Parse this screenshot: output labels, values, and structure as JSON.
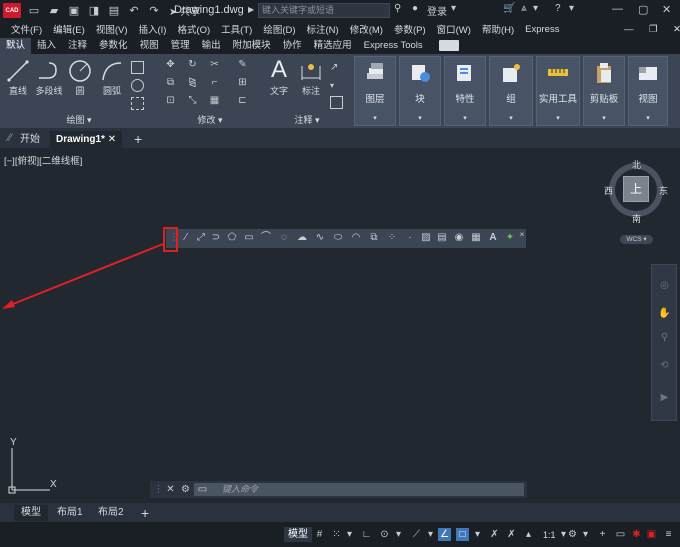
{
  "titlebar": {
    "logo": "CAD",
    "share": "共享",
    "document": "Drawing1.dwg",
    "search_placeholder": "键入关键字或短语",
    "login": "登录"
  },
  "menu": [
    "文件(F)",
    "编辑(E)",
    "视图(V)",
    "插入(I)",
    "格式(O)",
    "工具(T)",
    "绘图(D)",
    "标注(N)",
    "修改(M)",
    "参数(P)",
    "窗口(W)",
    "帮助(H)",
    "Express"
  ],
  "ribbon_tabs": [
    "默认",
    "插入",
    "注释",
    "参数化",
    "视图",
    "管理",
    "输出",
    "附加模块",
    "协作",
    "精选应用",
    "Express Tools"
  ],
  "ribbon": {
    "draw": {
      "line": "直线",
      "polyline": "多段线",
      "circle": "圆",
      "arc": "圆弧",
      "title": "绘图"
    },
    "modify": {
      "title": "修改"
    },
    "annotation": {
      "text": "文字",
      "dimension": "标注",
      "title": "注释"
    },
    "big": [
      "图层",
      "块",
      "特性",
      "组",
      "实用工具",
      "剪贴板",
      "视图"
    ]
  },
  "doc_tabs": {
    "start": "开始",
    "drawing": "Drawing1*"
  },
  "viewport_label": "[−][俯视][二维线框]",
  "viewcube": {
    "north": "北",
    "south": "南",
    "east": "东",
    "west": "西",
    "top": "上",
    "wcs": "WCS"
  },
  "command": {
    "placeholder": "键入命令"
  },
  "ucs": {
    "x": "X",
    "y": "Y"
  },
  "layout_tabs": [
    "模型",
    "布局1",
    "布局2"
  ],
  "status": {
    "model": "模型",
    "scale": "1:1"
  },
  "colors": {
    "accent": "#3f78b8",
    "highlight": "#e02020",
    "canvas": "#212830"
  }
}
